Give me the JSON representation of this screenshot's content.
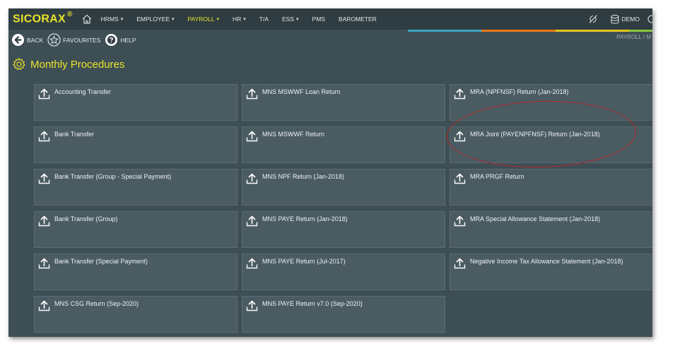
{
  "brand": {
    "name": "SICORAX",
    "reg": "®"
  },
  "nav": {
    "items": [
      {
        "label": "HRMS",
        "dropdown": true
      },
      {
        "label": "EMPLOYEE",
        "dropdown": true
      },
      {
        "label": "PAYROLL",
        "dropdown": true,
        "active": true
      },
      {
        "label": "HR",
        "dropdown": true
      },
      {
        "label": "T/A",
        "dropdown": false
      },
      {
        "label": "ESS",
        "dropdown": true
      },
      {
        "label": "PMS",
        "dropdown": false
      },
      {
        "label": "BAROMETER",
        "dropdown": false
      }
    ],
    "caret": "▾",
    "user_label": "DEMO"
  },
  "toolbar": {
    "back_label": "BACK",
    "favourites_label": "FAVOURITES",
    "help_label": "HELP"
  },
  "breadcrumb": "PAYROLL / M",
  "page": {
    "title": "Monthly Procedures"
  },
  "procedures": {
    "col1": [
      "Accounting Transfer",
      "Bank Transfer",
      "Bank Transfer (Group - Special Payment)",
      "Bank Transfer (Group)",
      "Bank Transfer (Special Payment)",
      "MNS CSG Return (Sep-2020)"
    ],
    "col2": [
      "MNS MSWWF Loan Return",
      "MNS MSWWF Return",
      "MNS NPF Return (Jan-2018)",
      "MNS PAYE Return (Jan-2018)",
      "MNS PAYE Return (Jul-2017)",
      "MNS PAYE Return v7.0 (Sep-2020)"
    ],
    "col3": [
      "MRA (NPFNSF) Return (Jan-2018)",
      "MRA Joint (PAYENPFNSF) Return (Jan-2018)",
      "MRA PRGF Return",
      "MRA Special Allowance Statement (Jan-2018)",
      "Negative Income Tax Allowance Statement (Jan-2018)"
    ]
  },
  "colors": {
    "accent_yellow": "#e8e42a",
    "bar_teal": "#3aa6b9",
    "bar_orange": "#e8781e",
    "bar_yellow": "#e6c520",
    "bar_green": "#8cc63f",
    "highlight_red": "#b02828"
  }
}
